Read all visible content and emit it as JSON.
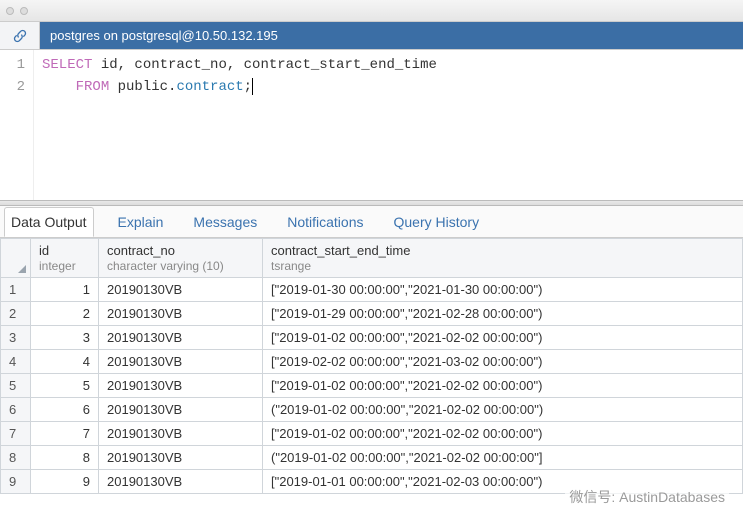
{
  "connection": {
    "label": "postgres on postgresql@10.50.132.195"
  },
  "editor": {
    "lines": [
      "1",
      "2"
    ],
    "sql": {
      "kw1": "SELECT",
      "cols": " id, contract_no, contract_start_end_time",
      "kw2": "FROM",
      "schema": " public.",
      "table": "contract",
      "semi": ";"
    }
  },
  "tabs": {
    "data_output": "Data Output",
    "explain": "Explain",
    "messages": "Messages",
    "notifications": "Notifications",
    "query_history": "Query History"
  },
  "columns": [
    {
      "name": "id",
      "type": "integer"
    },
    {
      "name": "contract_no",
      "type": "character varying (10)"
    },
    {
      "name": "contract_start_end_time",
      "type": "tsrange"
    }
  ],
  "rows": [
    {
      "n": "1",
      "id": "1",
      "contract_no": "20190130VB",
      "range": "[\"2019-01-30 00:00:00\",\"2021-01-30 00:00:00\")"
    },
    {
      "n": "2",
      "id": "2",
      "contract_no": "20190130VB",
      "range": "[\"2019-01-29 00:00:00\",\"2021-02-28 00:00:00\")"
    },
    {
      "n": "3",
      "id": "3",
      "contract_no": "20190130VB",
      "range": "[\"2019-01-02 00:00:00\",\"2021-02-02 00:00:00\")"
    },
    {
      "n": "4",
      "id": "4",
      "contract_no": "20190130VB",
      "range": "[\"2019-02-02 00:00:00\",\"2021-03-02 00:00:00\")"
    },
    {
      "n": "5",
      "id": "5",
      "contract_no": "20190130VB",
      "range": "[\"2019-01-02 00:00:00\",\"2021-02-02 00:00:00\")"
    },
    {
      "n": "6",
      "id": "6",
      "contract_no": "20190130VB",
      "range": "(\"2019-01-02 00:00:00\",\"2021-02-02 00:00:00\")"
    },
    {
      "n": "7",
      "id": "7",
      "contract_no": "20190130VB",
      "range": "[\"2019-01-02 00:00:00\",\"2021-02-02 00:00:00\")"
    },
    {
      "n": "8",
      "id": "8",
      "contract_no": "20190130VB",
      "range": "(\"2019-01-02 00:00:00\",\"2021-02-02 00:00:00\"]"
    },
    {
      "n": "9",
      "id": "9",
      "contract_no": "20190130VB",
      "range": "[\"2019-01-01 00:00:00\",\"2021-02-03 00:00:00\")"
    }
  ],
  "watermark": "微信号: AustinDatabases"
}
